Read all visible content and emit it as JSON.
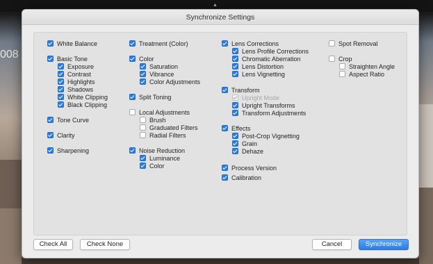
{
  "background": {
    "thumb_text": "008"
  },
  "dialog": {
    "title": "Synchronize Settings",
    "columns": [
      [
        {
          "label": "White Balance",
          "state": "on",
          "indent": 0,
          "y": 0
        },
        {
          "label": "Basic Tone",
          "state": "on",
          "indent": 0,
          "y": 1
        },
        {
          "label": "Exposure",
          "state": "on",
          "indent": 1,
          "y": 2
        },
        {
          "label": "Contrast",
          "state": "on",
          "indent": 1,
          "y": 3
        },
        {
          "label": "Highlights",
          "state": "on",
          "indent": 1,
          "y": 4
        },
        {
          "label": "Shadows",
          "state": "on",
          "indent": 1,
          "y": 5
        },
        {
          "label": "White Clipping",
          "state": "on",
          "indent": 1,
          "y": 6
        },
        {
          "label": "Black Clipping",
          "state": "on",
          "indent": 1,
          "y": 7
        },
        {
          "label": "Tone Curve",
          "state": "on",
          "indent": 0,
          "y": 8
        },
        {
          "label": "Clarity",
          "state": "on",
          "indent": 0,
          "y": 9
        },
        {
          "label": "Sharpening",
          "state": "on",
          "indent": 0,
          "y": 10
        }
      ],
      [
        {
          "label": "Treatment (Color)",
          "state": "on",
          "indent": 0,
          "y": 0
        },
        {
          "label": "Color",
          "state": "on",
          "indent": 0,
          "y": 1
        },
        {
          "label": "Saturation",
          "state": "on",
          "indent": 1,
          "y": 2
        },
        {
          "label": "Vibrance",
          "state": "on",
          "indent": 1,
          "y": 3
        },
        {
          "label": "Color Adjustments",
          "state": "on",
          "indent": 1,
          "y": 4
        },
        {
          "label": "Split Toning",
          "state": "on",
          "indent": 0,
          "y": 5
        },
        {
          "label": "Local Adjustments",
          "state": "off",
          "indent": 0,
          "y": 6
        },
        {
          "label": "Brush",
          "state": "off",
          "indent": 1,
          "y": 7
        },
        {
          "label": "Graduated Filters",
          "state": "off",
          "indent": 1,
          "y": 8
        },
        {
          "label": "Radial Filters",
          "state": "off",
          "indent": 1,
          "y": 9
        },
        {
          "label": "Noise Reduction",
          "state": "on",
          "indent": 0,
          "y": 10
        },
        {
          "label": "Luminance",
          "state": "on",
          "indent": 1,
          "y": 11
        },
        {
          "label": "Color",
          "state": "on",
          "indent": 1,
          "y": 12
        }
      ],
      [
        {
          "label": "Lens Corrections",
          "state": "on",
          "indent": 0,
          "y": 0
        },
        {
          "label": "Lens Profile Corrections",
          "state": "on",
          "indent": 1,
          "y": 1
        },
        {
          "label": "Chromatic Aberration",
          "state": "on",
          "indent": 1,
          "y": 2
        },
        {
          "label": "Lens Distortion",
          "state": "on",
          "indent": 1,
          "y": 3
        },
        {
          "label": "Lens Vignetting",
          "state": "on",
          "indent": 1,
          "y": 4
        },
        {
          "label": "Transform",
          "state": "on",
          "indent": 0,
          "y": 5
        },
        {
          "label": "Upright Mode",
          "state": "dis",
          "indent": 1,
          "y": 6
        },
        {
          "label": "Upright Transforms",
          "state": "on",
          "indent": 1,
          "y": 7
        },
        {
          "label": "Transform Adjustments",
          "state": "on",
          "indent": 1,
          "y": 8
        },
        {
          "label": "Effects",
          "state": "on",
          "indent": 0,
          "y": 9
        },
        {
          "label": "Post-Crop Vignetting",
          "state": "on",
          "indent": 1,
          "y": 10
        },
        {
          "label": "Grain",
          "state": "on",
          "indent": 1,
          "y": 11
        },
        {
          "label": "Dehaze",
          "state": "on",
          "indent": 1,
          "y": 12
        },
        {
          "label": "Process Version",
          "state": "on",
          "indent": 0,
          "y": 13
        },
        {
          "label": "Calibration",
          "state": "on",
          "indent": 0,
          "y": 14
        }
      ],
      [
        {
          "label": "Spot Removal",
          "state": "off",
          "indent": 0,
          "y": 0
        },
        {
          "label": "Crop",
          "state": "off",
          "indent": 0,
          "y": 1
        },
        {
          "label": "Straighten Angle",
          "state": "off",
          "indent": 1,
          "y": 2
        },
        {
          "label": "Aspect Ratio",
          "state": "off",
          "indent": 1,
          "y": 3
        }
      ]
    ],
    "buttons": {
      "check_all": "Check All",
      "check_none": "Check None",
      "cancel": "Cancel",
      "synchronize": "Synchronize"
    }
  }
}
